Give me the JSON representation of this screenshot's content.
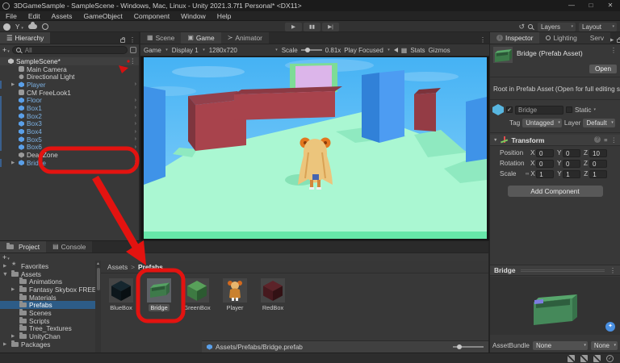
{
  "window": {
    "title": "3DGameSample - SampleScene - Windows, Mac, Linux - Unity 2021.3.7f1 Personal* <DX11>",
    "controls": {
      "minimize": "—",
      "maximize": "□",
      "close": "✕"
    }
  },
  "menu": {
    "items": [
      "File",
      "Edit",
      "Assets",
      "GameObject",
      "Component",
      "Window",
      "Help"
    ]
  },
  "toolbar": {
    "account_label": "Y",
    "layers_label": "Layers",
    "layout_label": "Layout"
  },
  "hierarchy": {
    "tab_title": "Hierarchy",
    "create_label": "+",
    "search_placeholder": "All",
    "items": [
      {
        "label": "SampleScene*",
        "type": "scene",
        "indent": 0,
        "header": true
      },
      {
        "label": "Main Camera",
        "type": "camera",
        "indent": 1
      },
      {
        "label": "Directional Light",
        "type": "light",
        "indent": 1
      },
      {
        "label": "Player",
        "type": "gameobject",
        "indent": 1,
        "prefab": true,
        "expand": true,
        "arrow": true
      },
      {
        "label": "CM FreeLook1",
        "type": "camera",
        "indent": 1
      },
      {
        "label": "Floor",
        "type": "gameobject",
        "indent": 1,
        "prefab": true,
        "arrow": true
      },
      {
        "label": "Box1",
        "type": "gameobject",
        "indent": 1,
        "prefab": true,
        "arrow": true
      },
      {
        "label": "Box2",
        "type": "gameobject",
        "indent": 1,
        "prefab": true,
        "arrow": true
      },
      {
        "label": "Box3",
        "type": "gameobject",
        "indent": 1,
        "prefab": true,
        "arrow": true
      },
      {
        "label": "Box4",
        "type": "gameobject",
        "indent": 1,
        "prefab": true,
        "arrow": true
      },
      {
        "label": "Box5",
        "type": "gameobject",
        "indent": 1,
        "prefab": true,
        "arrow": true
      },
      {
        "label": "Box6",
        "type": "gameobject",
        "indent": 1,
        "prefab": true,
        "arrow": true
      },
      {
        "label": "DeadZone",
        "type": "plain",
        "indent": 1
      },
      {
        "label": "Bridge",
        "type": "gameobject",
        "indent": 1,
        "prefab": true,
        "expand": true,
        "arrow": true
      }
    ]
  },
  "game_panel": {
    "tabs": {
      "scene": "Scene",
      "game": "Game",
      "animator": "Animator"
    },
    "controls": {
      "mode": "Game",
      "display": "Display 1",
      "resolution": "1280x720",
      "scale_label": "Scale",
      "scale_value": "0.81x",
      "focus_mode": "Play Focused",
      "stats_label": "Stats",
      "gizmos_label": "Gizmos"
    }
  },
  "inspector": {
    "tabs": {
      "inspector": "Inspector",
      "lighting": "Lighting",
      "services": "Serv"
    },
    "header": {
      "title": "Bridge (Prefab Asset)",
      "open_label": "Open"
    },
    "notice": "Root in Prefab Asset (Open for full editing sup",
    "object": {
      "check": "✓",
      "name": "Bridge",
      "static_label": "Static",
      "tag_label": "Tag",
      "tag": "Untagged",
      "layer_label": "Layer",
      "layer": "Default"
    },
    "transform": {
      "title": "Transform",
      "axis": [
        "X",
        "Y",
        "Z"
      ],
      "rows": [
        {
          "label": "Position",
          "x": "0",
          "y": "0",
          "z": "10"
        },
        {
          "label": "Rotation",
          "x": "0",
          "y": "0",
          "z": "0"
        },
        {
          "label": "Scale",
          "x": "1",
          "y": "1",
          "z": "1",
          "link": true
        }
      ]
    },
    "add_component_label": "Add Component",
    "preview": {
      "title": "Bridge"
    },
    "assetbundle": {
      "label": "AssetBundle",
      "value1": "None",
      "value2": "None"
    }
  },
  "project": {
    "tabs": {
      "project": "Project",
      "console": "Console"
    },
    "create_label": "+",
    "folders": [
      {
        "label": "Favorites",
        "type": "star",
        "indent": 0,
        "expand": true
      },
      {
        "label": "Assets",
        "type": "folder",
        "indent": 0,
        "expand": true,
        "open": true
      },
      {
        "label": "Animations",
        "type": "folder",
        "indent": 1
      },
      {
        "label": "Fantasy Skybox FREE",
        "type": "folder",
        "indent": 1,
        "expand": true
      },
      {
        "label": "Materials",
        "type": "folder",
        "indent": 1
      },
      {
        "label": "Prefabs",
        "type": "folder",
        "indent": 1,
        "selected": true
      },
      {
        "label": "Scenes",
        "type": "folder",
        "indent": 1
      },
      {
        "label": "Scripts",
        "type": "folder",
        "indent": 1
      },
      {
        "label": "Tree_Textures",
        "type": "folder",
        "indent": 1
      },
      {
        "label": "UnityChan",
        "type": "folder",
        "indent": 1,
        "expand": true
      },
      {
        "label": "Packages",
        "type": "folder",
        "indent": 0,
        "expand": true
      }
    ],
    "breadcrumb": {
      "root": "Assets",
      "sep": ">",
      "current": "Prefabs"
    },
    "assets": [
      {
        "label": "BlueBox",
        "type": "cube",
        "c_top": "#15262e",
        "c_front": "#0c161b",
        "c_side": "#080f12"
      },
      {
        "label": "Bridge",
        "type": "bridge",
        "selected": true
      },
      {
        "label": "GreenBox",
        "type": "cube",
        "c_top": "#58a05a",
        "c_front": "#3d7a42",
        "c_side": "#2c5a31"
      },
      {
        "label": "Player",
        "type": "player"
      },
      {
        "label": "RedBox",
        "type": "cube",
        "c_top": "#5c2329",
        "c_front": "#46191e",
        "c_side": "#321114"
      }
    ],
    "selected_path": "Assets/Prefabs/Bridge.prefab"
  },
  "colors": {
    "annotation_red": "#e31310",
    "prefab_blue": "#7cb1e3",
    "selection_blue": "#2d5c87",
    "sky_blue": "#4db5f5",
    "ground_mint": "#aaf7d2"
  }
}
